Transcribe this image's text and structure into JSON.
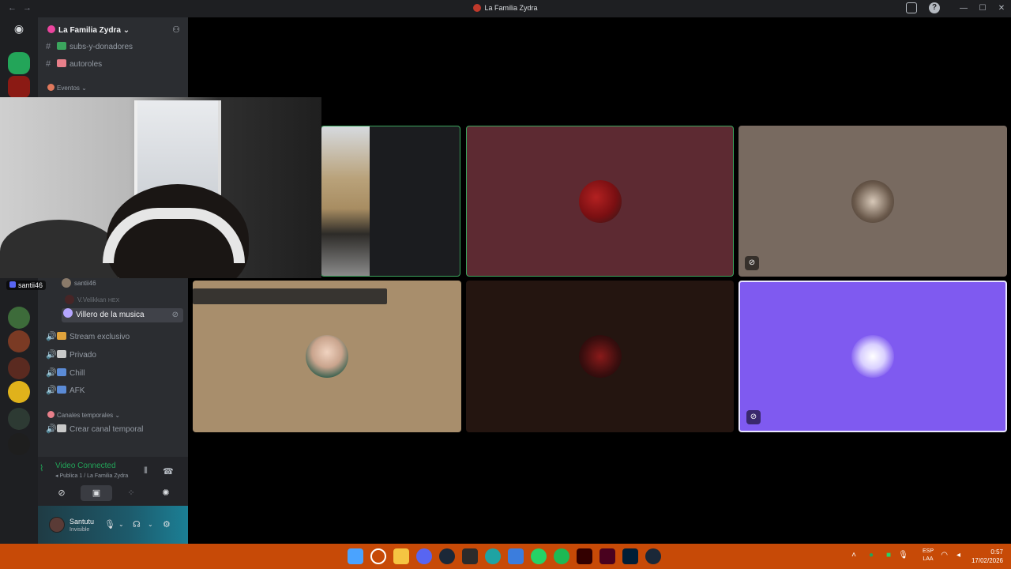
{
  "window": {
    "title": "La Familia Zydra",
    "nav_back": "←",
    "nav_forward": "→",
    "minimize": "—",
    "maximize": "☐",
    "close": "✕",
    "help": "?"
  },
  "guild": {
    "name": "La Familia Zydra",
    "chevron": "⌄",
    "invite_icon": "person-add-icon"
  },
  "channels": [
    {
      "name": "subs-y-donadores"
    },
    {
      "name": "autoroles"
    }
  ],
  "category_events": "Eventos",
  "voice_members": [
    {
      "name": "santii46"
    },
    {
      "name": "V.Velikkan"
    },
    {
      "badge": "HEX"
    }
  ],
  "voice_channels": [
    {
      "name": "Villero de la musica"
    },
    {
      "name": "Stream exclusivo"
    },
    {
      "name": "Privado"
    },
    {
      "name": "Chill"
    },
    {
      "name": "AFK"
    }
  ],
  "category_temp": "Canales temporales",
  "temp_channel": "Crear canal temporal",
  "voice_panel": {
    "status": "Video Connected",
    "channel": "Publica 1 / La Familia Zydra"
  },
  "user": {
    "name": "Santutu",
    "status": "Invisible"
  },
  "stage": {
    "self_name": "santii46"
  },
  "taskbar": {
    "lang_line1": "ESP",
    "lang_line2": "LAA",
    "time": "0:57",
    "date": "17/02/2026"
  },
  "colors": {
    "accent": "#5865f2",
    "connected": "#23a559",
    "speaking_border": "#3ba55d",
    "taskbar": "#c74a07",
    "tile_maroon": "#5d2a32",
    "tile_taupe": "#786a60",
    "tile_tan": "#a88e6c",
    "tile_dark": "#241510",
    "tile_purple": "#7f5af0"
  }
}
